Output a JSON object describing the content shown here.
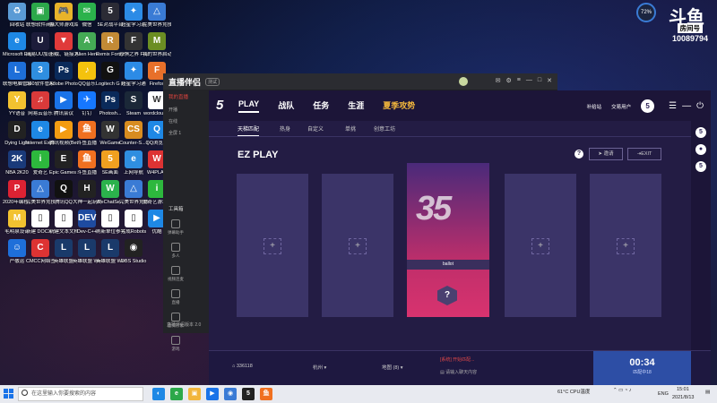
{
  "desktop": {
    "icons": [
      {
        "label": "回收站",
        "color": "#5b9bd5",
        "glyph": "♻"
      },
      {
        "label": "联想软件商店",
        "color": "#2ca84a",
        "glyph": "▣"
      },
      {
        "label": "鲁大师游戏库",
        "color": "#e8b32a",
        "glyph": "🎮"
      },
      {
        "label": "微信",
        "color": "#2bb24c",
        "glyph": "✉"
      },
      {
        "label": "5E对战平台",
        "color": "#2b2b35",
        "glyph": "5"
      },
      {
        "label": "超星学习通",
        "color": "#2c8be6",
        "glyph": "✦"
      },
      {
        "label": "完美世界竞技...",
        "color": "#3a7bd5",
        "glyph": "△"
      },
      {
        "label": "Microsoft Edge",
        "color": "#1e88e5",
        "glyph": "e"
      },
      {
        "label": "网易UU加速器",
        "color": "#1c1c3a",
        "glyph": "U"
      },
      {
        "label": "下载、链接方式",
        "color": "#e03a3a",
        "glyph": "▼"
      },
      {
        "label": "Alien Hero",
        "color": "#44aa55",
        "glyph": "A"
      },
      {
        "label": "Remix Fortune -...",
        "color": "#c28a36",
        "glyph": "R"
      },
      {
        "label": "恐惧之界 Fear sur...",
        "color": "#333",
        "glyph": "F"
      },
      {
        "label": "我的世界启动器",
        "color": "#6b8e23",
        "glyph": "M"
      },
      {
        "label": "联想电脑管家",
        "color": "#1e6fd9",
        "glyph": "L"
      },
      {
        "label": "360软件管家",
        "color": "#2f8ee0",
        "glyph": "3"
      },
      {
        "label": "Adobe Photosh...",
        "color": "#0a2a5a",
        "glyph": "Ps"
      },
      {
        "label": "QQ音乐",
        "color": "#f4c20d",
        "glyph": "♪"
      },
      {
        "label": "Logitech G HUB",
        "color": "#111",
        "glyph": "G"
      },
      {
        "label": "超星学习通",
        "color": "#2c8be6",
        "glyph": "✦"
      },
      {
        "label": "Firefox",
        "color": "#e8702a",
        "glyph": "F"
      },
      {
        "label": "YY语音",
        "color": "#f2c230",
        "glyph": "Y"
      },
      {
        "label": "网易云音乐",
        "color": "#d93a3a",
        "glyph": "♫"
      },
      {
        "label": "腾讯会议",
        "color": "#1a73e8",
        "glyph": "▶"
      },
      {
        "label": "钉钉",
        "color": "#1677ff",
        "glyph": "✈"
      },
      {
        "label": "Photosh...",
        "color": "#0a2a5a",
        "glyph": "Ps"
      },
      {
        "label": "Steam",
        "color": "#1b2838",
        "glyph": "S"
      },
      {
        "label": "wordcloud...",
        "color": "#fff",
        "glyph": "W"
      },
      {
        "label": "Dying Light",
        "color": "#222",
        "glyph": "D"
      },
      {
        "label": "Internet Explorer",
        "color": "#1e88e5",
        "glyph": "e"
      },
      {
        "label": "腾讯视频(Beta版)",
        "color": "#f39c12",
        "glyph": "▶"
      },
      {
        "label": "斗鱼直播",
        "color": "#f07020",
        "glyph": "鱼"
      },
      {
        "label": "WeGame",
        "color": "#333",
        "glyph": "W"
      },
      {
        "label": "Counter-S... Global Off...",
        "color": "#d88c20",
        "glyph": "CS"
      },
      {
        "label": "QQ浏览器",
        "color": "#1e88e5",
        "glyph": "Q"
      },
      {
        "label": "NBA 2K20",
        "color": "#1a3a7a",
        "glyph": "2K"
      },
      {
        "label": "爱奇艺",
        "color": "#2db83d",
        "glyph": "i"
      },
      {
        "label": "Epic Games Launcher",
        "color": "#222",
        "glyph": "E"
      },
      {
        "label": "斗鱼直播",
        "color": "#f07020",
        "glyph": "鱼"
      },
      {
        "label": "5E画面",
        "color": "#f0a020",
        "glyph": "5"
      },
      {
        "label": "上网导航",
        "color": "#2f8ee0",
        "glyph": "e"
      },
      {
        "label": "W4PLAY",
        "color": "#d33",
        "glyph": "W"
      },
      {
        "label": "2020年编程...",
        "color": "#d23",
        "glyph": "P"
      },
      {
        "label": "完美世界竞技...",
        "color": "#3a7bd5",
        "glyph": "△"
      },
      {
        "label": "腾讯QQ",
        "color": "#111",
        "glyph": "Q"
      },
      {
        "label": "大神一起玩的 Hunter Ta...",
        "color": "#222",
        "glyph": "H"
      },
      {
        "label": "WeChatSe...",
        "color": "#2bb24c",
        "glyph": "W"
      },
      {
        "label": "完美世界竞技平台",
        "color": "#3a7bd5",
        "glyph": "△"
      },
      {
        "label": "爱奇艺游戏中心",
        "color": "#2db83d",
        "glyph": "i"
      },
      {
        "label": "毛明泉设计",
        "color": "#f2c230",
        "glyph": "M"
      },
      {
        "label": "新建 DOCX 文档",
        "color": "#fff",
        "glyph": "▯"
      },
      {
        "label": "新建文本文档",
        "color": "#fff",
        "glyph": "▯"
      },
      {
        "label": "Dev-C++",
        "color": "#1e4ba0",
        "glyph": "DEV"
      },
      {
        "label": "刷新单位参考",
        "color": "#fff",
        "glyph": "▯"
      },
      {
        "label": "完成Robots",
        "color": "#fff",
        "glyph": "▯"
      },
      {
        "label": "优酷",
        "color": "#1e88e5",
        "glyph": "▶"
      },
      {
        "label": "严敬运",
        "color": "#1e6fd9",
        "glyph": "☺"
      },
      {
        "label": "CMCC网络签到大学",
        "color": "#d33",
        "glyph": "C"
      },
      {
        "label": "英雄联盟",
        "color": "#1a3a6a",
        "glyph": "L"
      },
      {
        "label": "英雄联盟 WeGame版",
        "color": "#1a3a6a",
        "glyph": "L"
      },
      {
        "label": "英雄联盟 WeGame版",
        "color": "#1a3a6a",
        "glyph": "L"
      },
      {
        "label": "OBS Studio",
        "color": "#222",
        "glyph": "◉"
      }
    ]
  },
  "badge": {
    "gauge": "72%",
    "logo": "斗鱼",
    "room_label": "房间号",
    "room_number": "10089794"
  },
  "companion": {
    "title": "直播伴侣",
    "tag": "测试",
    "side_head": "我的直播",
    "side_items": [
      "开播",
      "在线",
      "全屏 1"
    ],
    "section": "工具箱",
    "tools": [
      "弹幕助手",
      "多人",
      "视频连麦",
      "直播",
      "虚拟形象",
      "游戏"
    ],
    "bottom": "直播伴侣版本 2.0"
  },
  "game": {
    "logo": "5",
    "nav": [
      {
        "label": "PLAY",
        "active": true
      },
      {
        "label": "战队"
      },
      {
        "label": "任务"
      },
      {
        "label": "生涯"
      },
      {
        "label": "夏季攻势",
        "gold": true
      }
    ],
    "top_right": {
      "bonus": "补给站",
      "friends": "交易用户",
      "avatar": "5"
    },
    "sub_tabs": [
      "天梯匹配",
      "热身",
      "自定义",
      "单挑",
      "创意工坊"
    ],
    "mode_title": "EZ PLAY",
    "invite_button": "邀请",
    "exit_button": "EXIT",
    "player": {
      "number": "35",
      "name": "ballot"
    },
    "rank_glyph": "?",
    "bottom": {
      "coins": "336118",
      "region": "杭州",
      "map": "地图 (8)",
      "system_msg": "[系统] 开始匹配...",
      "chat_placeholder": "请输入聊天内容",
      "timer": "00:34",
      "timer_label": "匹配中18"
    },
    "rail": [
      "5",
      "●",
      "5"
    ]
  },
  "taskbar": {
    "search_placeholder": "在这里输入你要搜索的内容",
    "apps": [
      {
        "glyph": "◐",
        "color": "#1e88e5"
      },
      {
        "glyph": "e",
        "color": "#2ca84a"
      },
      {
        "glyph": "▣",
        "color": "#f2b63c"
      },
      {
        "glyph": "▶",
        "color": "#1a73e8"
      },
      {
        "glyph": "◉",
        "color": "#3a7bd5"
      },
      {
        "glyph": "5",
        "color": "#222"
      },
      {
        "glyph": "鱼",
        "color": "#f07020"
      }
    ],
    "weather": "61°C CPU温度",
    "lang": "ENG",
    "time": "15:01",
    "date": "2021/8/13"
  }
}
